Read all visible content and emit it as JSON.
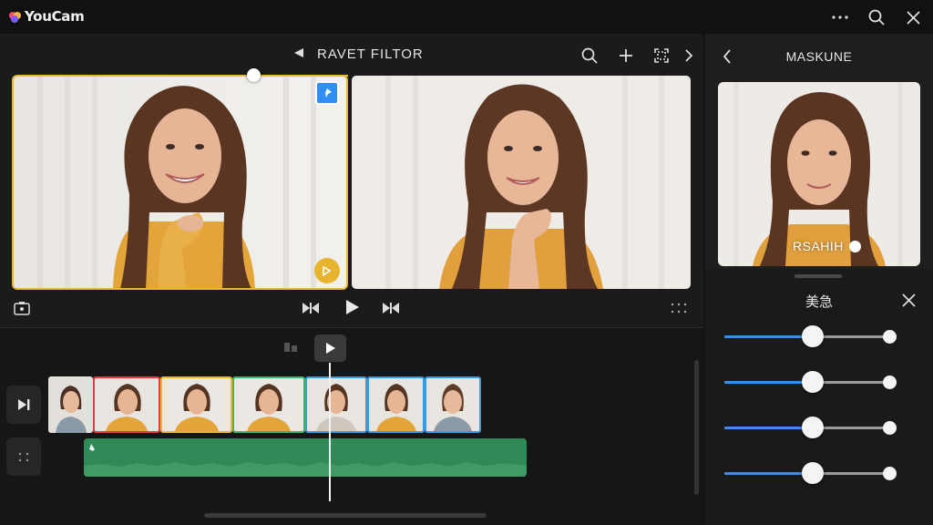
{
  "app": {
    "name": "YouCam"
  },
  "titlebar": {
    "more_icon": "more-horizontal-icon",
    "search_icon": "search-icon",
    "close_icon": "close-icon"
  },
  "editor": {
    "title": "RAVET FILTOR",
    "back_icon": "triangle-left-icon",
    "toolbar_icons": [
      "search-icon",
      "plus-icon",
      "crop-icon",
      "chevron-right-icon"
    ],
    "scrub_position": 0.72
  },
  "previews": [
    {
      "id": "left",
      "selected": true,
      "badges": [
        "pin-icon",
        "wand-icon"
      ]
    },
    {
      "id": "right",
      "selected": false
    }
  ],
  "playback_controls": [
    "snapshot-icon",
    "skip-back-icon",
    "play-icon",
    "skip-forward-icon",
    "grid-icon"
  ],
  "timeline": {
    "clips": [
      {
        "accent": "#dcdcdc"
      },
      {
        "accent": "#e53b3b"
      },
      {
        "accent": "#e8b833"
      },
      {
        "accent": "#3fb36a"
      },
      {
        "accent": "#3a9be0"
      },
      {
        "accent": "#3a9be0"
      },
      {
        "accent": "#3a9be0"
      }
    ],
    "audio_color": "#2f8a57",
    "playhead_color": "#f2f2f2"
  },
  "panel": {
    "title": "MASKUNE",
    "image_label": "RSAHIH",
    "sheet_title": "美急",
    "sliders": [
      0.52,
      0.52,
      0.52,
      0.52
    ],
    "accent": "#3b8fe8"
  }
}
